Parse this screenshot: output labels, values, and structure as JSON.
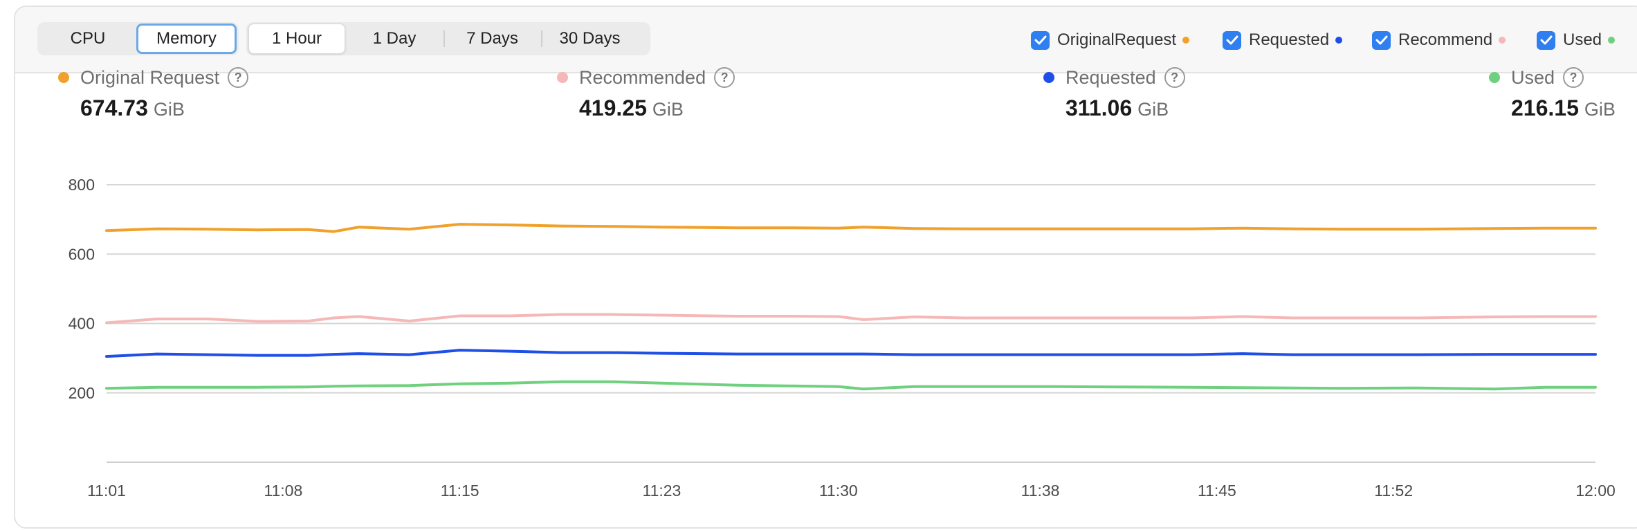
{
  "toolbar": {
    "resource_tabs": [
      {
        "label": "CPU",
        "active": false
      },
      {
        "label": "Memory",
        "active": true
      }
    ],
    "time_ranges": [
      {
        "label": "1 Hour",
        "active": true
      },
      {
        "label": "1 Day",
        "active": false
      },
      {
        "label": "7 Days",
        "active": false
      },
      {
        "label": "30 Days",
        "active": false
      }
    ],
    "legend_toggles": [
      {
        "label": "OriginalRequest",
        "checked": true,
        "color": "#f0a12c"
      },
      {
        "label": "Requested",
        "checked": true,
        "color": "#1f4fe6"
      },
      {
        "label": "Recommend",
        "checked": true,
        "color": "#f5b8b8"
      },
      {
        "label": "Used",
        "checked": true,
        "color": "#6fd07f"
      }
    ]
  },
  "metrics": [
    {
      "label": "Original Request",
      "value": "674.73",
      "unit": "GiB",
      "color": "#f0a12c"
    },
    {
      "label": "Recommended",
      "value": "419.25",
      "unit": "GiB",
      "color": "#f5b8b8"
    },
    {
      "label": "Requested",
      "value": "311.06",
      "unit": "GiB",
      "color": "#1f4fe6"
    },
    {
      "label": "Used",
      "value": "216.15",
      "unit": "GiB",
      "color": "#6fd07f"
    }
  ],
  "help_symbol": "?",
  "chart_data": {
    "type": "line",
    "title": "",
    "xlabel": "",
    "ylabel": "",
    "ylim": [
      0,
      800
    ],
    "y_ticks": [
      "800",
      "600",
      "400",
      "200"
    ],
    "x_tick_labels": [
      "11:01",
      "11:08",
      "11:15",
      "11:23",
      "11:30",
      "11:38",
      "11:45",
      "11:52",
      "12:00"
    ],
    "grid": true,
    "x": [
      "11:01",
      "11:03",
      "11:05",
      "11:07",
      "11:09",
      "11:10",
      "11:11",
      "11:13",
      "11:15",
      "11:17",
      "11:19",
      "11:21",
      "11:23",
      "11:26",
      "11:28",
      "11:30",
      "11:31",
      "11:33",
      "11:35",
      "11:38",
      "11:41",
      "11:44",
      "11:46",
      "11:48",
      "11:50",
      "11:53",
      "11:56",
      "11:58",
      "12:00"
    ],
    "series": [
      {
        "name": "OriginalRequest",
        "color": "#f0a12c",
        "values": [
          668,
          673,
          672,
          670,
          671,
          665,
          678,
          672,
          686,
          684,
          681,
          680,
          678,
          676,
          676,
          675,
          678,
          674,
          673,
          673,
          673,
          673,
          675,
          673,
          672,
          672,
          674,
          675,
          675
        ]
      },
      {
        "name": "Recommend",
        "color": "#f5b8b8",
        "values": [
          402,
          413,
          413,
          406,
          407,
          416,
          420,
          407,
          422,
          422,
          426,
          426,
          424,
          421,
          421,
          420,
          411,
          419,
          416,
          416,
          416,
          416,
          420,
          416,
          416,
          416,
          419,
          420,
          420
        ]
      },
      {
        "name": "Requested",
        "color": "#1f4fe6",
        "values": [
          305,
          312,
          310,
          308,
          308,
          311,
          313,
          310,
          323,
          320,
          316,
          316,
          314,
          312,
          312,
          312,
          312,
          310,
          310,
          310,
          310,
          310,
          313,
          310,
          310,
          310,
          311,
          311,
          311
        ]
      },
      {
        "name": "Used",
        "color": "#6fd07f",
        "values": [
          213,
          216,
          216,
          216,
          217,
          219,
          220,
          221,
          226,
          228,
          232,
          232,
          228,
          222,
          220,
          218,
          211,
          218,
          218,
          218,
          217,
          216,
          215,
          214,
          213,
          214,
          211,
          216,
          216
        ]
      }
    ]
  }
}
